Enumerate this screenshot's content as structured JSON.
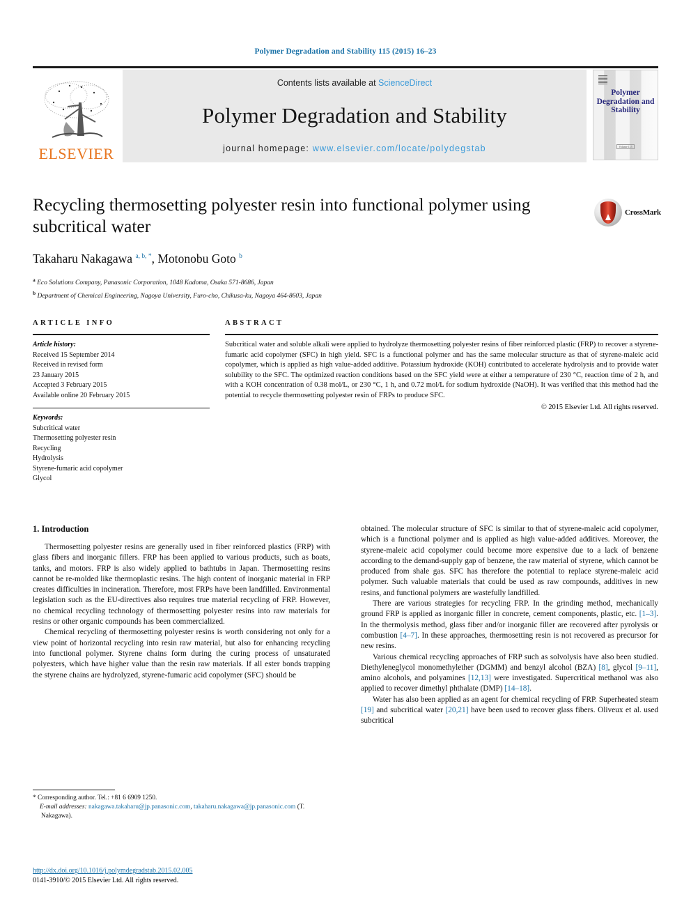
{
  "running_head": "Polymer Degradation and Stability 115 (2015) 16–23",
  "masthead": {
    "elsevier_word": "ELSEVIER",
    "contents_prefix": "Contents lists available at ",
    "sciencedirect": "ScienceDirect",
    "journal_name": "Polymer Degradation and Stability",
    "homepage_prefix": "journal homepage: ",
    "homepage_url": "www.elsevier.com/locate/polydegstab",
    "cover_title": "Polymer Degradation and Stability",
    "cover_footer": "Volume 115"
  },
  "article": {
    "title": "Recycling thermosetting polyester resin into functional polymer using subcritical water",
    "crossmark_label": "CrossMark",
    "authors_html": "Takaharu Nakagawa <sup>a, b, *</sup>, Motonobu Goto <sup>b</sup>",
    "affiliation_a": "Eco Solutions Company, Panasonic Corporation, 1048 Kadoma, Osaka 571-8686, Japan",
    "affiliation_b": "Department of Chemical Engineering, Nagoya University, Furo-cho, Chikusa-ku, Nagoya 464-8603, Japan"
  },
  "article_info": {
    "heading": "ARTICLE INFO",
    "history_label": "Article history:",
    "history": [
      "Received 15 September 2014",
      "Received in revised form",
      "23 January 2015",
      "Accepted 3 February 2015",
      "Available online 20 February 2015"
    ],
    "keywords_label": "Keywords:",
    "keywords": [
      "Subcritical water",
      "Thermosetting polyester resin",
      "Recycling",
      "Hydrolysis",
      "Styrene-fumaric acid copolymer",
      "Glycol"
    ]
  },
  "abstract": {
    "heading": "ABSTRACT",
    "text": "Subcritical water and soluble alkali were applied to hydrolyze thermosetting polyester resins of fiber reinforced plastic (FRP) to recover a styrene-fumaric acid copolymer (SFC) in high yield. SFC is a functional polymer and has the same molecular structure as that of styrene-maleic acid copolymer, which is applied as high value-added additive. Potassium hydroxide (KOH) contributed to accelerate hydrolysis and to provide water solubility to the SFC. The optimized reaction conditions based on the SFC yield were at either a temperature of 230 °C, reaction time of 2 h, and with a KOH concentration of 0.38 mol/L, or 230 °C, 1 h, and 0.72 mol/L for sodium hydroxide (NaOH). It was verified that this method had the potential to recycle thermosetting polyester resin of FRPs to produce SFC.",
    "copyright": "© 2015 Elsevier Ltd. All rights reserved."
  },
  "body": {
    "section_number_title": "1. Introduction",
    "left_paragraphs": [
      "Thermosetting polyester resins are generally used in fiber reinforced plastics (FRP) with glass fibers and inorganic fillers. FRP has been applied to various products, such as boats, tanks, and motors. FRP is also widely applied to bathtubs in Japan. Thermosetting resins cannot be re-molded like thermoplastic resins. The high content of inorganic material in FRP creates difficulties in incineration. Therefore, most FRPs have been landfilled. Environmental legislation such as the EU-directives also requires true material recycling of FRP. However, no chemical recycling technology of thermosetting polyester resins into raw materials for resins or other organic compounds has been commercialized.",
      "Chemical recycling of thermosetting polyester resins is worth considering not only for a view point of horizontal recycling into resin raw material, but also for enhancing recycling into functional polymer. Styrene chains form during the curing process of unsaturated polyesters, which have higher value than the resin raw materials. If all ester bonds trapping the styrene chains are hydrolyzed, styrene-fumaric acid copolymer (SFC) should be"
    ],
    "right_paragraphs": [
      "obtained. The molecular structure of SFC is similar to that of styrene-maleic acid copolymer, which is a functional polymer and is applied as high value-added additives. Moreover, the styrene-maleic acid copolymer could become more expensive due to a lack of benzene according to the demand-supply gap of benzene, the raw material of styrene, which cannot be produced from shale gas. SFC has therefore the potential to replace styrene-maleic acid polymer. Such valuable materials that could be used as raw compounds, additives in new resins, and functional polymers are wastefully landfilled.",
      "There are various strategies for recycling FRP. In the grinding method, mechanically ground FRP is applied as inorganic filler in concrete, cement components, plastic, etc. [1–3]. In the thermolysis method, glass fiber and/or inorganic filler are recovered after pyrolysis or combustion [4–7]. In these approaches, thermosetting resin is not recovered as precursor for new resins.",
      "Various chemical recycling approaches of FRP such as solvolysis have also been studied. Diethyleneglycol monomethylether (DGMM) and benzyl alcohol (BZA) [8], glycol [9–11], amino alcohols, and polyamines [12,13] were investigated. Supercritical methanol was also applied to recover dimethyl phthalate (DMP) [14–18].",
      "Water has also been applied as an agent for chemical recycling of FRP. Superheated steam [19] and subcritical water [20,21] have been used to recover glass fibers. Oliveux et al. used subcritical"
    ],
    "right_paragraph_refs": {
      "p2": [
        "[1–3]",
        "[4–7]"
      ],
      "p3": [
        "[8]",
        "[9–11]",
        "[12,13]",
        "[14–18]"
      ],
      "p4": [
        "[19]",
        "[20,21]"
      ]
    }
  },
  "footnote": {
    "corresponding": "* Corresponding author. Tel.: +81 6 6909 1250.",
    "email_label": "E-mail addresses:",
    "email1": "nakagawa.takaharu@jp.panasonic.com",
    "email2": "takaharu.nakagawa@jp.panasonic.com",
    "email_suffix": "(T. Nakagawa)."
  },
  "doi": {
    "url": "http://dx.doi.org/10.1016/j.polymdegradstab.2015.02.005",
    "issn_line": "0141-3910/© 2015 Elsevier Ltd. All rights reserved."
  },
  "colors": {
    "link": "#1b72a8",
    "sciencedirect": "#3a9ad9",
    "elsevier_orange": "#e87722",
    "cover_navy": "#25257a"
  }
}
